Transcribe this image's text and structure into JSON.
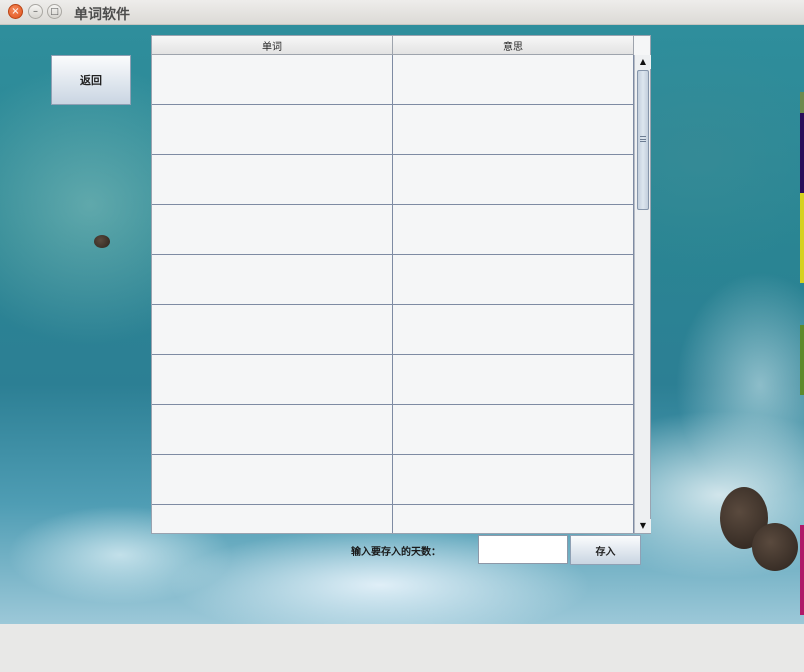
{
  "window": {
    "title": "单词软件",
    "close_glyph": "×",
    "minimize_glyph": "–",
    "maximize_glyph": "□"
  },
  "toolbar": {
    "back_label": "返回"
  },
  "table": {
    "columns": [
      "单词",
      "意思"
    ],
    "rows": [
      [
        "",
        ""
      ],
      [
        "",
        ""
      ],
      [
        "",
        ""
      ],
      [
        "",
        ""
      ],
      [
        "",
        ""
      ],
      [
        "",
        ""
      ],
      [
        "",
        ""
      ],
      [
        "",
        ""
      ],
      [
        "",
        ""
      ],
      [
        "",
        ""
      ]
    ]
  },
  "scrollbar": {
    "up_glyph": "▲",
    "down_glyph": "▼"
  },
  "save_form": {
    "days_label": "输入要存入的天数：",
    "days_value": "",
    "save_label": "存入"
  },
  "colors": {
    "accent": "#c9d5e2",
    "ocean": "#2c7f94",
    "close_button": "#e0511c"
  }
}
